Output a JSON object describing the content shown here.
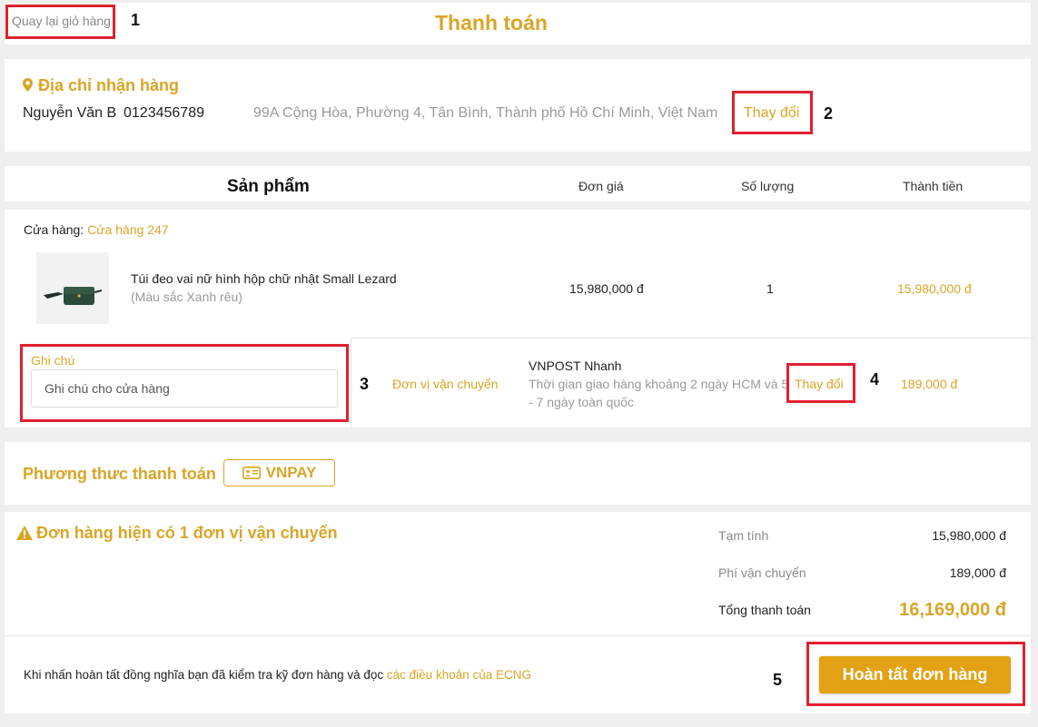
{
  "header": {
    "back_label": "Quay lại giỏ hàng",
    "title": "Thanh toán"
  },
  "address": {
    "title": "Địa chỉ nhận hàng",
    "name": "Nguyễn Văn B",
    "phone": "0123456789",
    "full_address": "99A Cộng Hòa, Phường 4, Tân Bình, Thành phố Hồ Chí Minh, Việt Nam",
    "change_label": "Thay đổi"
  },
  "table_header": {
    "product": "Sản phẩm",
    "unit_price": "Đơn giá",
    "quantity": "Số lượng",
    "total": "Thành tiền"
  },
  "order": {
    "store_label": "Cửa hàng:",
    "store_name": "Cửa hàng 247",
    "product_name": "Túi đeo vai nữ hình hộp chữ nhật Small Lezard",
    "product_variant": "(Màu sắc Xanh rêu)",
    "unit_price": "15,980,000 đ",
    "quantity": "1",
    "total": "15,980,000 đ",
    "note_label": "Ghi chú",
    "note_placeholder": "Ghi chú cho cửa hàng",
    "shipping_label": "Đơn vị vận chuyển",
    "shipping_name": "VNPOST Nhanh",
    "shipping_desc_line1": "Thời gian giao hàng khoảng 2 ngày HCM và 5",
    "shipping_desc_line2": "- 7 ngày toàn quốc",
    "shipping_change_label": "Thay đổi",
    "shipping_fee": "189,000 đ"
  },
  "payment": {
    "label": "Phương thưc thanh toán",
    "method": "VNPAY"
  },
  "summary": {
    "warning": "Đơn hàng hiện có 1 đơn vị vận chuyển",
    "subtotal_label": "Tạm tính",
    "subtotal_value": "15,980,000 đ",
    "shipping_label": "Phí vận chuyển",
    "shipping_value": "189,000 đ",
    "total_label": "Tổng thanh toán",
    "total_value": "16,169,000 đ",
    "terms_prefix": "Khi nhấn hoàn tất đồng nghĩa bạn đã kiểm tra kỹ đơn hàng và đọc",
    "terms_link": "các điều khoản của ECNG",
    "complete_label": "Hoàn tất đơn hàng"
  },
  "annotations": [
    "1",
    "2",
    "3",
    "4",
    "5"
  ],
  "colors": {
    "accent": "#d9a526",
    "button": "#e2a214",
    "annotation_box": "#e0202e"
  }
}
